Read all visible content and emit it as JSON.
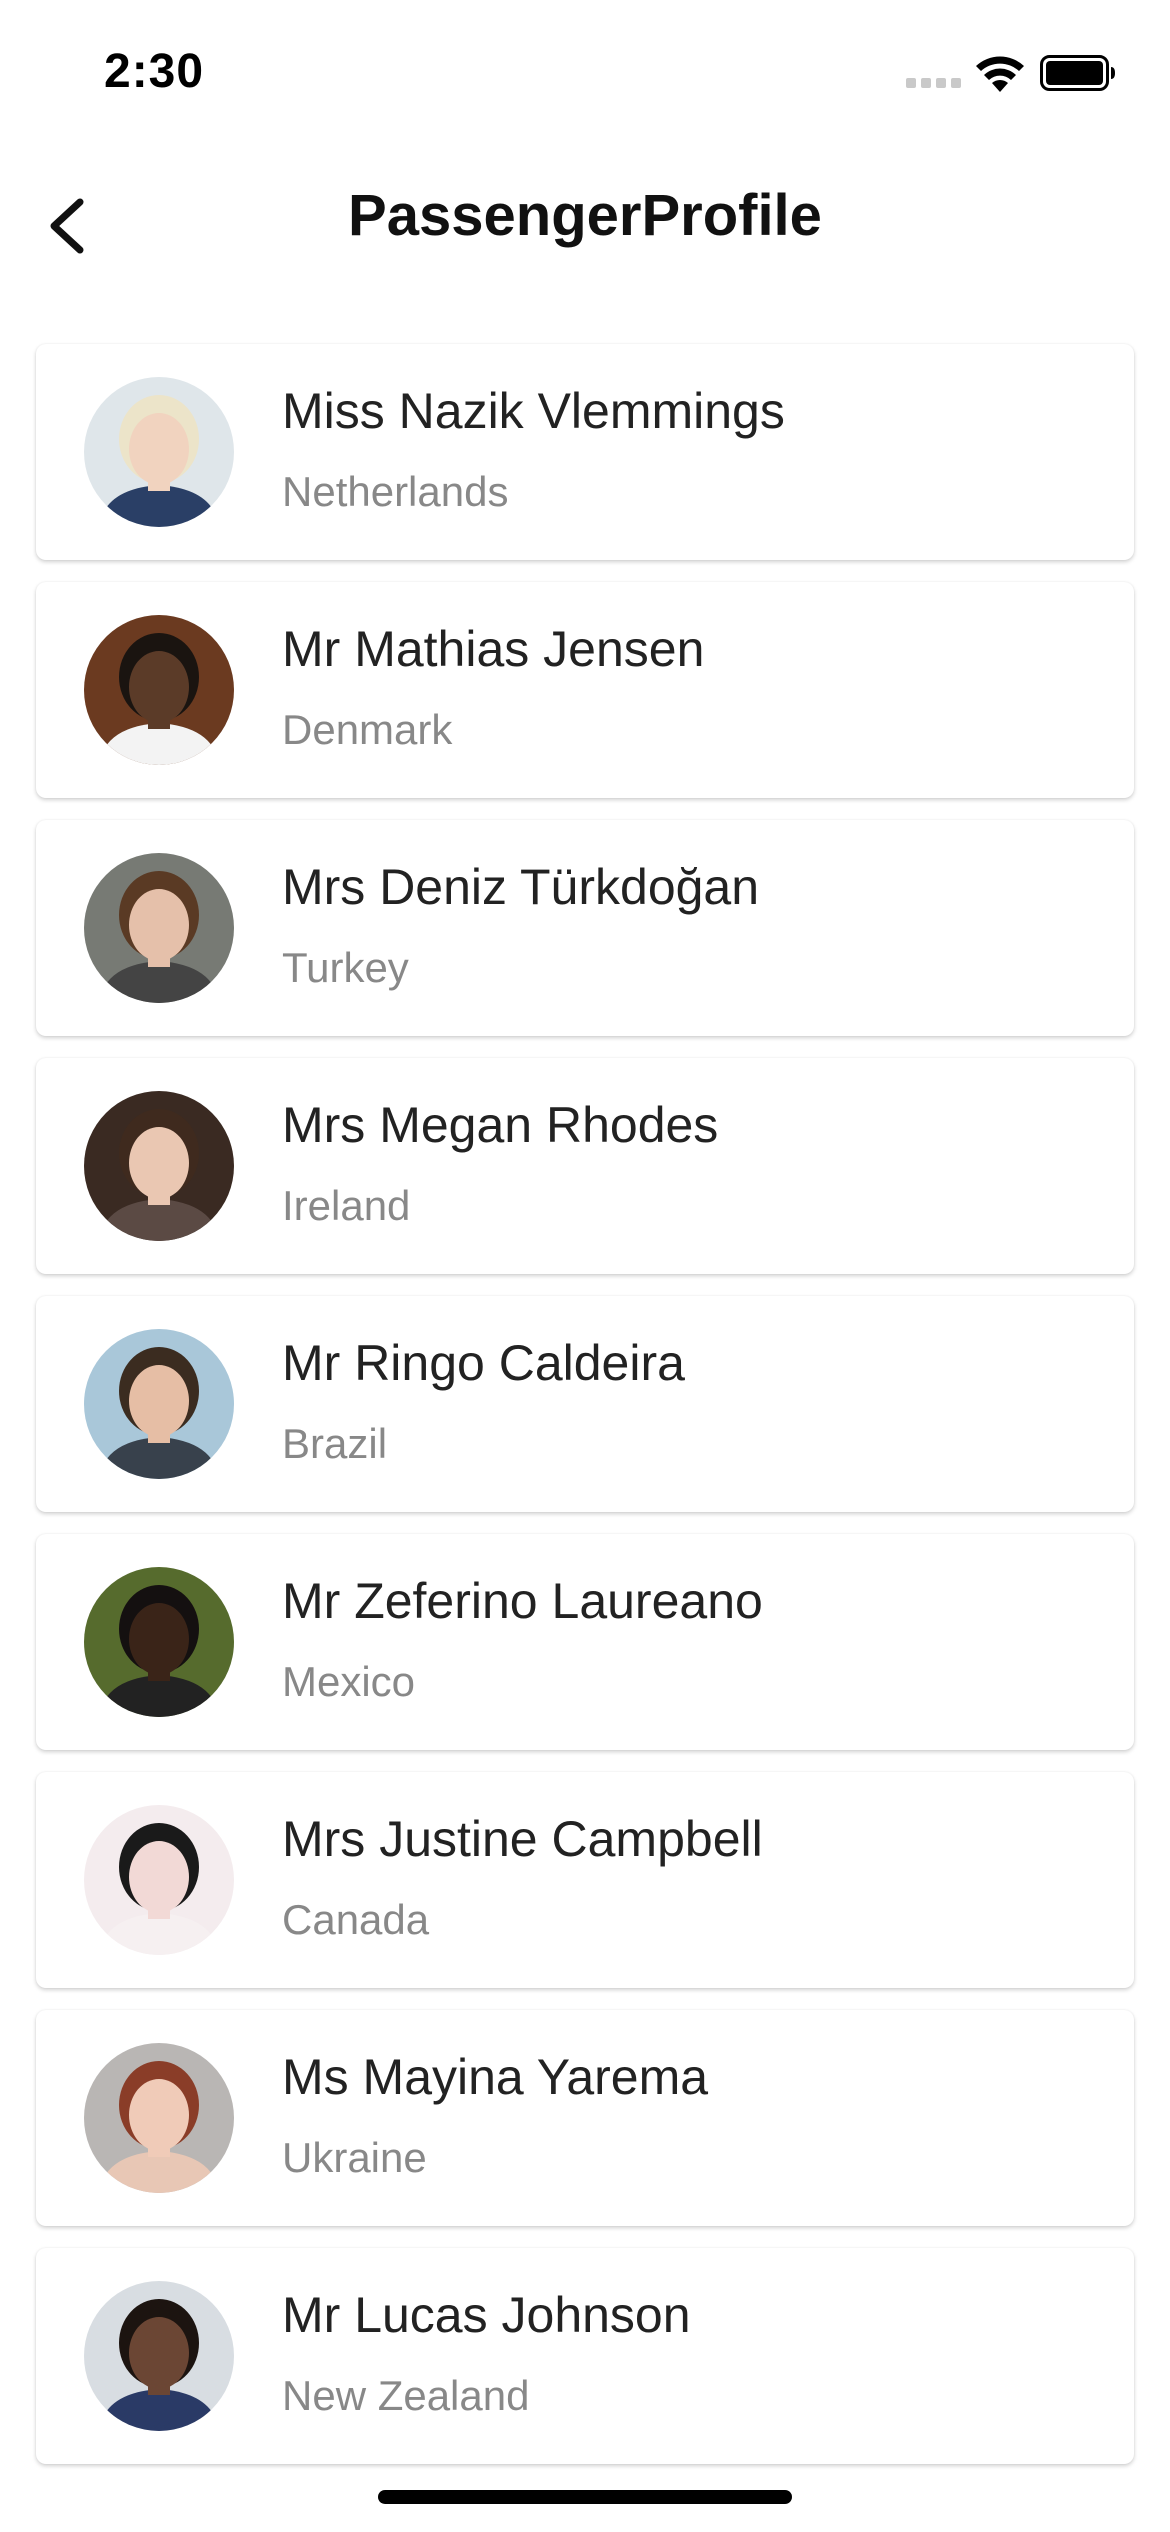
{
  "status_bar": {
    "time": "2:30"
  },
  "nav": {
    "title": "PassengerProfile"
  },
  "passengers": [
    {
      "name": "Miss Nazik Vlemmings",
      "country": "Netherlands",
      "avatar_bg": "#dfe6ea",
      "skin": "#f1d3bf",
      "hair": "#ece4c9",
      "shirt": "#2a3f66"
    },
    {
      "name": "Mr Mathias Jensen",
      "country": "Denmark",
      "avatar_bg": "#6b3a20",
      "skin": "#5b3b28",
      "hair": "#1a1410",
      "shirt": "#f3f3f3"
    },
    {
      "name": "Mrs Deniz Türkdoğan",
      "country": "Turkey",
      "avatar_bg": "#777a74",
      "skin": "#e5c0aa",
      "hair": "#5a3a24",
      "shirt": "#444444"
    },
    {
      "name": "Mrs Megan Rhodes",
      "country": "Ireland",
      "avatar_bg": "#3a2a22",
      "skin": "#eac7b2",
      "hair": "#3f2a1e",
      "shirt": "#5b4a44"
    },
    {
      "name": "Mr Ringo Caldeira",
      "country": "Brazil",
      "avatar_bg": "#a9c7d9",
      "skin": "#e6bea5",
      "hair": "#3b2c20",
      "shirt": "#38414c"
    },
    {
      "name": "Mr Zeferino Laureano",
      "country": "Mexico",
      "avatar_bg": "#566b2d",
      "skin": "#3a2418",
      "hair": "#141010",
      "shirt": "#222222"
    },
    {
      "name": "Mrs Justine Campbell",
      "country": "Canada",
      "avatar_bg": "#f4ecee",
      "skin": "#f2d9d6",
      "hair": "#1a1a1a",
      "shirt": "#f6f0f1"
    },
    {
      "name": "Ms Mayina Yarema",
      "country": "Ukraine",
      "avatar_bg": "#b9b6b4",
      "skin": "#f0cbb8",
      "hair": "#8a3d28",
      "shirt": "#e8c7b5"
    },
    {
      "name": "Mr Lucas Johnson",
      "country": "New Zealand",
      "avatar_bg": "#d8dde2",
      "skin": "#6b4634",
      "hair": "#1c1410",
      "shirt": "#2a3a66"
    }
  ]
}
